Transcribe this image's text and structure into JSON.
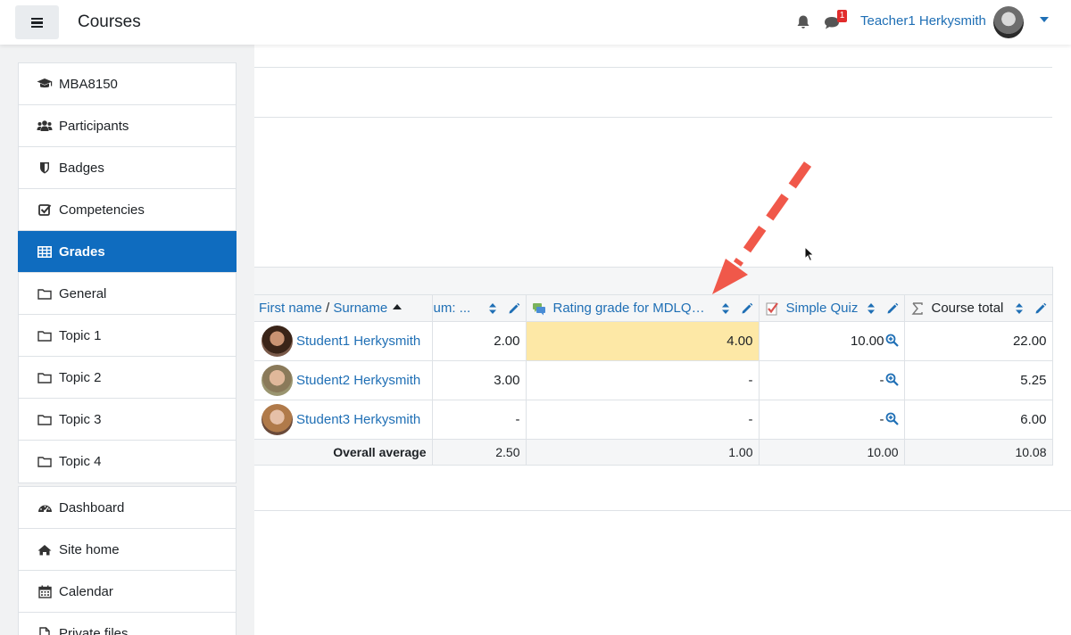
{
  "navbar": {
    "menu_toggle": "menu",
    "title": "Courses",
    "notification_count": "1",
    "user_name": "Teacher1 Herkysmith"
  },
  "sidebar": {
    "course_items": [
      {
        "label": "MBA8150",
        "icon": "graduation-cap-icon"
      },
      {
        "label": "Participants",
        "icon": "users-icon"
      },
      {
        "label": "Badges",
        "icon": "shield-icon"
      },
      {
        "label": "Competencies",
        "icon": "checkbox-icon"
      },
      {
        "label": "Grades",
        "icon": "table-icon",
        "active": true
      },
      {
        "label": "General",
        "icon": "folder-icon"
      },
      {
        "label": "Topic 1",
        "icon": "folder-icon"
      },
      {
        "label": "Topic 2",
        "icon": "folder-icon"
      },
      {
        "label": "Topic 3",
        "icon": "folder-icon"
      },
      {
        "label": "Topic 4",
        "icon": "folder-icon"
      }
    ],
    "site_items": [
      {
        "label": "Dashboard",
        "icon": "dashboard-icon"
      },
      {
        "label": "Site home",
        "icon": "home-icon"
      },
      {
        "label": "Calendar",
        "icon": "calendar-icon"
      },
      {
        "label": "Private files",
        "icon": "file-icon"
      }
    ]
  },
  "grader": {
    "header": {
      "first_name": "First name",
      "separator": " / ",
      "surname": "Surname",
      "col_forum": "um: ...",
      "col_rating": "Rating grade for MDLQA-...",
      "col_quiz": "Simple Quiz",
      "col_total": "Course total"
    },
    "students": [
      {
        "name": "Student1 Herkysmith",
        "forum": "2.00",
        "rating": "4.00",
        "quiz": "10.00",
        "total": "22.00"
      },
      {
        "name": "Student2 Herkysmith",
        "forum": "3.00",
        "rating": "-",
        "quiz": "-",
        "total": "5.25"
      },
      {
        "name": "Student3 Herkysmith",
        "forum": "-",
        "rating": "-",
        "quiz": "-",
        "total": "6.00"
      }
    ],
    "average": {
      "label": "Overall average",
      "forum": "2.50",
      "rating": "1.00",
      "quiz": "10.00",
      "total": "10.08"
    }
  },
  "colors": {
    "accent": "#0f6cbf",
    "link": "#1f6fb5",
    "highlight": "#fde8a6",
    "annotation_arrow": "#f0584a"
  }
}
